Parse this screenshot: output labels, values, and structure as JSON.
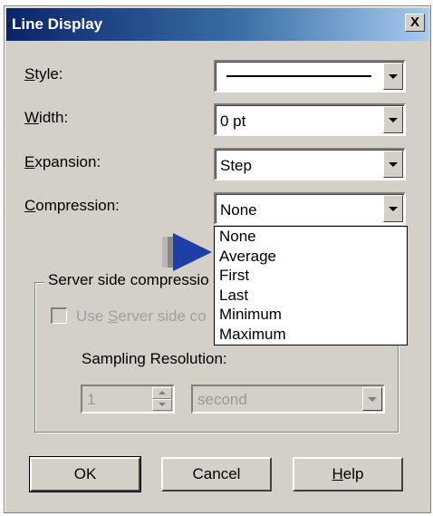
{
  "window": {
    "title": "Line Display",
    "close_glyph": "X"
  },
  "fields": {
    "style": {
      "label_mnemonic": "S",
      "label_rest": "tyle:"
    },
    "width": {
      "label_mnemonic": "W",
      "label_rest": "idth:",
      "value": "0 pt"
    },
    "expansion": {
      "label_mnemonic": "E",
      "label_rest": "xpansion:",
      "value": "Step"
    },
    "compression": {
      "label_mnemonic": "C",
      "label_rest": "ompression:",
      "value": "None"
    }
  },
  "compression_options": [
    "None",
    "Average",
    "First",
    "Last",
    "Minimum",
    "Maximum"
  ],
  "server_group": {
    "caption": "Server side compressio",
    "checkbox_prefix": "Use ",
    "checkbox_mnemonic": "S",
    "checkbox_rest": "erver side co",
    "checked": false,
    "sampling_label": "Sampling Resolution:",
    "sampling_value": "1",
    "sampling_unit": "second"
  },
  "buttons": {
    "ok": "OK",
    "cancel": "Cancel",
    "help_mnemonic": "H",
    "help_rest": "elp"
  },
  "icons": {
    "pointer": "blue-arrow-icon"
  },
  "colors": {
    "pointer_blue": "#1f3fa8",
    "pointer_gray": "#8a8a8a"
  }
}
